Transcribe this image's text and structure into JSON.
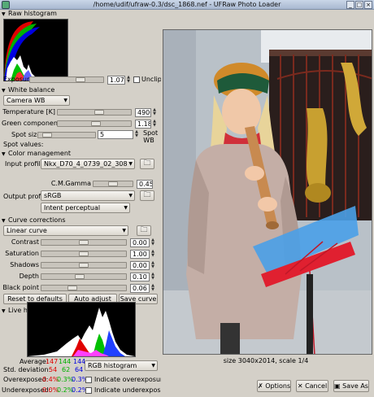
{
  "window": {
    "title": "/home/udif/ufraw-0.3/dsc_1868.nef - UFRaw Photo Loader"
  },
  "raw_histogram": {
    "header": "Raw histogram"
  },
  "exposure": {
    "label": "Exposure",
    "value": "1.07",
    "unclip_label": "Unclip"
  },
  "white_balance": {
    "header": "White balance",
    "preset": "Camera WB",
    "temperature_label": "Temperature [K]",
    "temperature_value": "4900",
    "green_label": "Green component",
    "green_value": "1.18",
    "spot_size_label": "Spot size",
    "spot_size_value": "5",
    "spot_wb_label_1": "Spot",
    "spot_wb_label_2": "WB",
    "spot_values_label": "Spot values:"
  },
  "color_management": {
    "header": "Color management",
    "input_profile_label": "Input profile",
    "input_profile_value": "Nkx_D70_4_0739_02_308",
    "gamma_label": "C.M.Gamma",
    "gamma_value": "0.45",
    "output_profile_label": "Output profile",
    "output_profile_value": "sRGB",
    "intent_value": "Intent perceptual"
  },
  "curve_corrections": {
    "header": "Curve corrections",
    "curve_value": "Linear curve",
    "contrast_label": "Contrast",
    "contrast_value": "0.00",
    "saturation_label": "Saturation",
    "saturation_value": "1.00",
    "shadows_label": "Shadows",
    "shadows_value": "0.00",
    "depth_label": "Depth",
    "depth_value": "0.10",
    "black_point_label": "Black point",
    "black_point_value": "0.06",
    "reset_label": "Reset to defaults",
    "auto_adjust_label": "Auto adjust",
    "save_curve_label": "Save curve"
  },
  "live_histogram": {
    "header": "Live histogram",
    "average_label": "Average:",
    "average_r": "147",
    "average_g": "144",
    "average_b": "144",
    "std_label": "Std. deviation:",
    "std_r": "54",
    "std_g": "62",
    "std_b": "64",
    "histogram_type": "RGB histogram",
    "overexposed_label": "Overexposed:",
    "over_r": "0.4%",
    "over_g": "0.3%",
    "over_b": "0.3%",
    "indicate_over_label": "Indicate overexposure",
    "underexposed_label": "Underexposed:",
    "under_r": "0.0%",
    "under_g": "0.2%",
    "under_b": "0.2%",
    "indicate_under_label": "Indicate underexposure"
  },
  "preview": {
    "size_text": "size 3040x2014, scale 1/4"
  },
  "actions": {
    "options_label": "Options",
    "cancel_label": "Cancel",
    "save_as_label": "Save As"
  },
  "colors": {
    "red": "#e00000",
    "green": "#00b000",
    "blue": "#0000e0"
  },
  "slider_levels": {
    "exposure": 0.72,
    "temperature": 0.58,
    "green": 0.52,
    "spot_size": 0.08,
    "contrast": 0.5,
    "saturation": 0.5,
    "shadows": 0.5,
    "depth": 0.45,
    "black_point": 0.35
  }
}
